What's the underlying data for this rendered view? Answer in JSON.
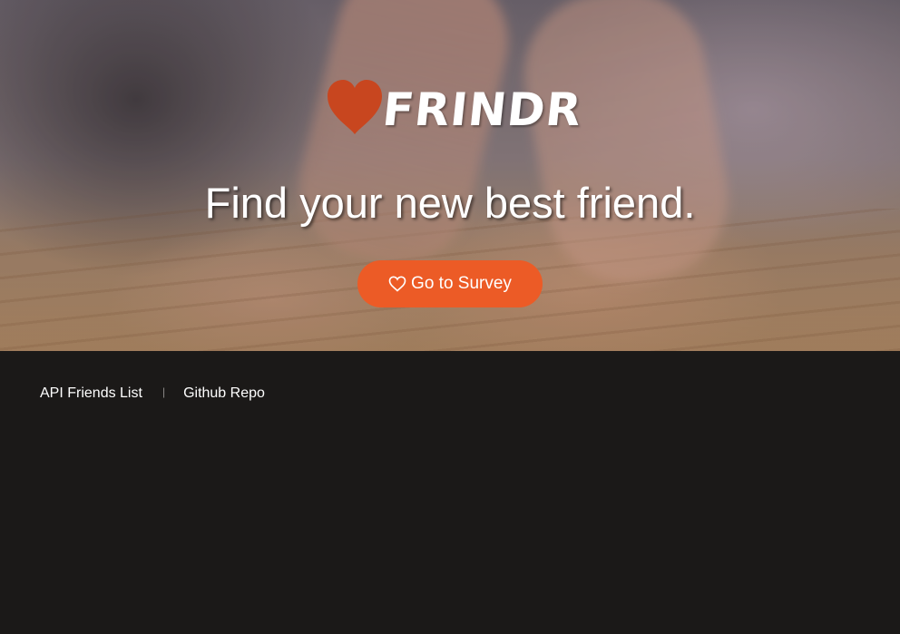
{
  "hero": {
    "logo": {
      "icon": "heart-icon",
      "wordmark": "FRINDR",
      "heart_color": "#c8461f"
    },
    "tagline": "Find your new best friend.",
    "cta": {
      "label": "Go to Survey",
      "icon": "heart-outline-icon",
      "color": "#ec5b26"
    }
  },
  "footer": {
    "links": [
      {
        "label": "API Friends List"
      },
      {
        "label": "Github Repo"
      }
    ],
    "separator": "|"
  }
}
